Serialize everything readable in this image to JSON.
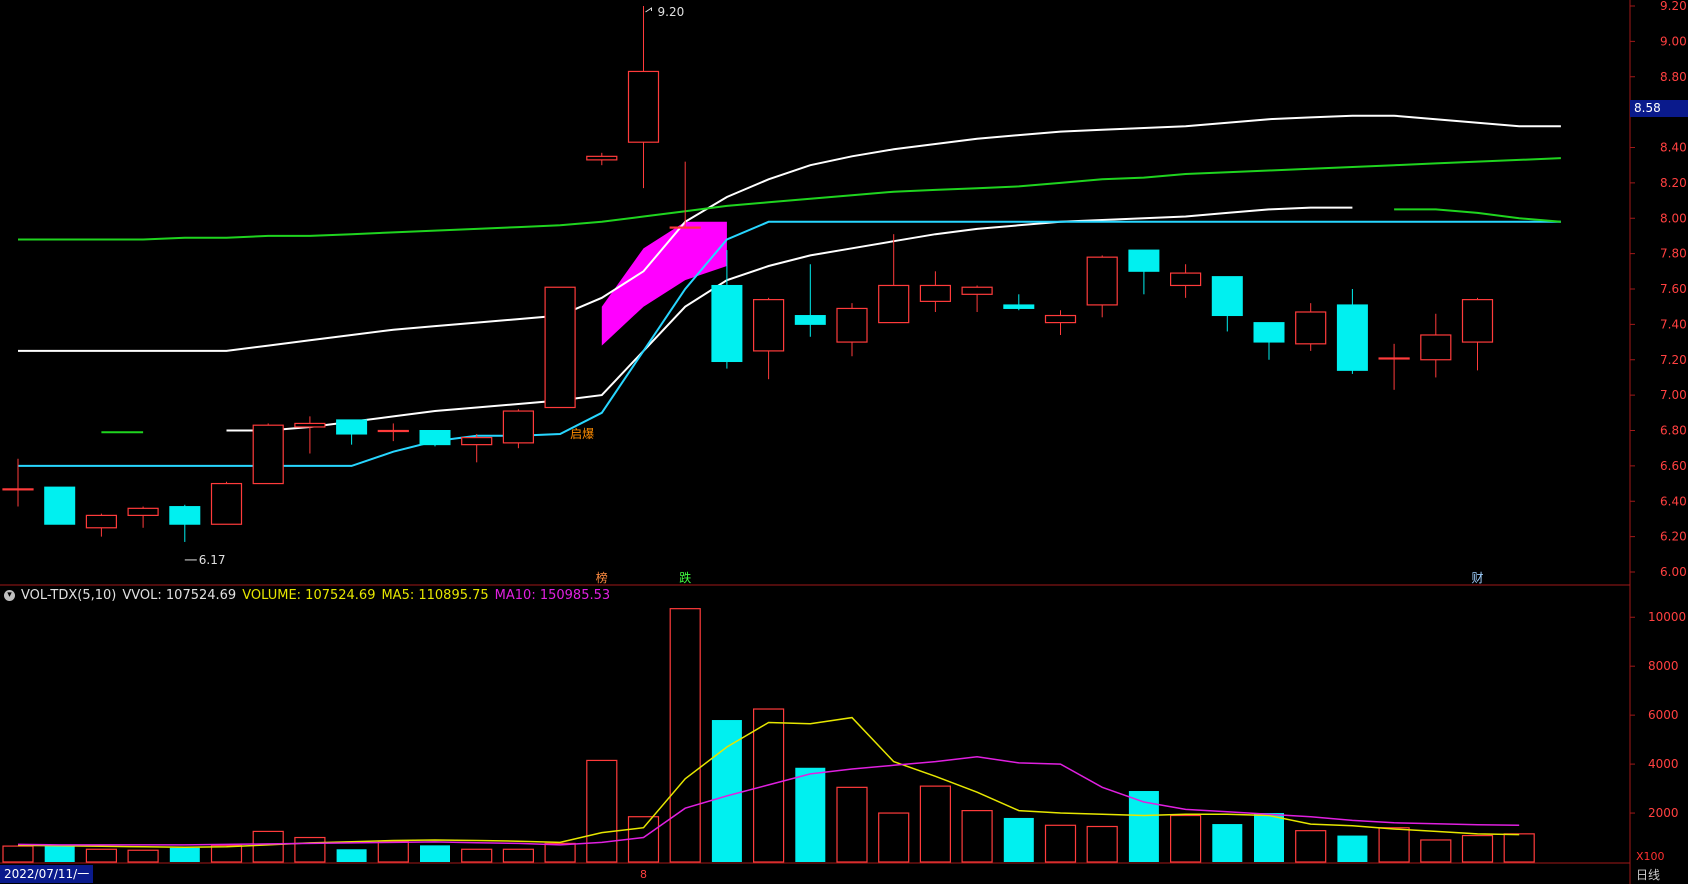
{
  "colors": {
    "up": "#ff3b3b",
    "down": "#00f0f0",
    "ma_white": "#ffffff",
    "ma_green": "#1fd41f",
    "ma_cyan": "#28d6ff",
    "fill_magenta": "#ff00ff",
    "vol_ma5": "#e6e600",
    "vol_ma10": "#e020e0",
    "axis": "#a01818",
    "grid": "#5a0d0d"
  },
  "header": {
    "indicator": "VOL-TDX(5,10)",
    "vvol": "VVOL: 107524.69",
    "volume": "VOLUME: 107524.69",
    "ma5": "MA5: 110895.75",
    "ma10": "MA10: 150985.53"
  },
  "footer": {
    "date": "2022/07/11/一",
    "period": "日线",
    "x_marker": "8",
    "vol_unit": "X100"
  },
  "current_price_tag": "8.58",
  "annotations": {
    "high_label": "9.20",
    "low_label": "6.17",
    "event_label": "启爆",
    "marker_bang": "榜",
    "marker_die": "跌",
    "marker_cai": "财"
  },
  "chart_data": [
    {
      "type": "candlestick",
      "ylim": [
        6.0,
        9.2
      ],
      "y_ticks": [
        "6.00",
        "6.20",
        "6.40",
        "6.60",
        "6.80",
        "7.00",
        "7.20",
        "7.40",
        "7.60",
        "7.80",
        "8.00",
        "8.20",
        "8.40",
        "8.60",
        "8.80",
        "9.00",
        "9.20"
      ],
      "candles": [
        {
          "o": 6.47,
          "h": 6.64,
          "l": 6.37,
          "c": 6.47
        },
        {
          "o": 6.48,
          "h": 6.48,
          "l": 6.27,
          "c": 6.27
        },
        {
          "o": 6.25,
          "h": 6.33,
          "l": 6.2,
          "c": 6.32
        },
        {
          "o": 6.32,
          "h": 6.37,
          "l": 6.25,
          "c": 6.36
        },
        {
          "o": 6.37,
          "h": 6.38,
          "l": 6.17,
          "c": 6.27
        },
        {
          "o": 6.27,
          "h": 6.51,
          "l": 6.27,
          "c": 6.5
        },
        {
          "o": 6.5,
          "h": 6.84,
          "l": 6.5,
          "c": 6.83
        },
        {
          "o": 6.82,
          "h": 6.88,
          "l": 6.67,
          "c": 6.84
        },
        {
          "o": 6.86,
          "h": 6.86,
          "l": 6.72,
          "c": 6.78
        },
        {
          "o": 6.8,
          "h": 6.84,
          "l": 6.74,
          "c": 6.8
        },
        {
          "o": 6.8,
          "h": 6.8,
          "l": 6.71,
          "c": 6.72
        },
        {
          "o": 6.72,
          "h": 6.78,
          "l": 6.62,
          "c": 6.76
        },
        {
          "o": 6.73,
          "h": 6.92,
          "l": 6.7,
          "c": 6.91
        },
        {
          "o": 6.93,
          "h": 7.61,
          "l": 6.93,
          "c": 7.61
        },
        {
          "o": 8.33,
          "h": 8.37,
          "l": 8.3,
          "c": 8.35
        },
        {
          "o": 8.43,
          "h": 9.2,
          "l": 8.17,
          "c": 8.83
        },
        {
          "o": 7.95,
          "h": 8.32,
          "l": 7.95,
          "c": 7.95
        },
        {
          "o": 7.62,
          "h": 7.82,
          "l": 7.15,
          "c": 7.19
        },
        {
          "o": 7.25,
          "h": 7.55,
          "l": 7.09,
          "c": 7.54
        },
        {
          "o": 7.45,
          "h": 7.74,
          "l": 7.33,
          "c": 7.4
        },
        {
          "o": 7.3,
          "h": 7.52,
          "l": 7.22,
          "c": 7.49
        },
        {
          "o": 7.41,
          "h": 7.91,
          "l": 7.41,
          "c": 7.62
        },
        {
          "o": 7.53,
          "h": 7.7,
          "l": 7.47,
          "c": 7.62
        },
        {
          "o": 7.57,
          "h": 7.62,
          "l": 7.47,
          "c": 7.61
        },
        {
          "o": 7.51,
          "h": 7.57,
          "l": 7.48,
          "c": 7.49
        },
        {
          "o": 7.41,
          "h": 7.48,
          "l": 7.34,
          "c": 7.45
        },
        {
          "o": 7.51,
          "h": 7.79,
          "l": 7.44,
          "c": 7.78
        },
        {
          "o": 7.82,
          "h": 7.82,
          "l": 7.57,
          "c": 7.7
        },
        {
          "o": 7.62,
          "h": 7.74,
          "l": 7.55,
          "c": 7.69
        },
        {
          "o": 7.67,
          "h": 7.67,
          "l": 7.36,
          "c": 7.45
        },
        {
          "o": 7.41,
          "h": 7.41,
          "l": 7.2,
          "c": 7.3
        },
        {
          "o": 7.29,
          "h": 7.52,
          "l": 7.25,
          "c": 7.47
        },
        {
          "o": 7.51,
          "h": 7.6,
          "l": 7.12,
          "c": 7.14
        },
        {
          "o": 7.21,
          "h": 7.29,
          "l": 7.03,
          "c": 7.21
        },
        {
          "o": 7.2,
          "h": 7.46,
          "l": 7.1,
          "c": 7.34
        },
        {
          "o": 7.3,
          "h": 7.55,
          "l": 7.14,
          "c": 7.54
        }
      ],
      "ma_white_upper": [
        7.25,
        7.25,
        7.25,
        7.25,
        7.25,
        7.25,
        7.28,
        7.31,
        7.34,
        7.37,
        7.39,
        7.41,
        7.43,
        7.45,
        7.55,
        7.7,
        7.98,
        8.12,
        8.22,
        8.3,
        8.35,
        8.39,
        8.42,
        8.45,
        8.47,
        8.49,
        8.5,
        8.51,
        8.52,
        8.54,
        8.56,
        8.57,
        8.58,
        8.58,
        8.56,
        8.54,
        8.52,
        8.52
      ],
      "ma_white_lower": [
        6.8,
        null,
        6.8,
        null,
        null,
        6.8,
        6.8,
        6.82,
        6.85,
        6.88,
        6.91,
        6.93,
        6.95,
        6.97,
        7.0,
        7.25,
        7.5,
        7.65,
        7.73,
        7.79,
        7.83,
        7.87,
        7.91,
        7.94,
        7.96,
        7.98,
        7.99,
        8.0,
        8.01,
        8.03,
        8.05,
        8.06,
        8.06
      ],
      "ma_green_upper": [
        7.88,
        7.88,
        7.88,
        7.88,
        7.89,
        7.89,
        7.9,
        7.9,
        7.91,
        7.92,
        7.93,
        7.94,
        7.95,
        7.96,
        7.98,
        8.01,
        8.04,
        8.07,
        8.09,
        8.11,
        8.13,
        8.15,
        8.16,
        8.17,
        8.18,
        8.2,
        8.22,
        8.23,
        8.25,
        8.26,
        8.27,
        8.28,
        8.29,
        8.3,
        8.31,
        8.32,
        8.33,
        8.34
      ],
      "ma_green_lower": [
        6.79,
        null,
        6.79,
        6.79
      ],
      "ma_cyan": [
        6.6,
        6.6,
        6.6,
        6.6,
        6.6,
        6.6,
        6.6,
        6.6,
        6.6,
        6.68,
        6.74,
        6.77,
        6.77,
        6.78,
        6.9,
        7.25,
        7.6,
        7.88,
        7.98,
        7.98,
        7.98,
        7.98,
        7.98,
        7.98,
        7.98,
        7.98,
        7.98,
        7.98,
        7.98,
        7.98,
        7.98,
        7.98,
        7.98,
        7.98,
        7.98,
        7.98,
        7.98,
        7.98
      ],
      "ma_green_tail": [
        8.05,
        8.05,
        8.03,
        8.0,
        7.98
      ]
    },
    {
      "type": "volume",
      "ylim": [
        0,
        10500
      ],
      "y_ticks": [
        "2000",
        "4000",
        "6000",
        "8000",
        "10000"
      ],
      "unit": "X100",
      "volumes": [
        650,
        650,
        520,
        480,
        580,
        680,
        1250,
        1000,
        520,
        850,
        680,
        520,
        520,
        760,
        4150,
        1850,
        10350,
        5800,
        6250,
        3850,
        3050,
        2000,
        3100,
        2100,
        1800,
        1500,
        1450,
        2900,
        1900,
        1550,
        2000,
        1280,
        1080,
        1400,
        900,
        1080,
        1150
      ],
      "vol_ma5": [
        680,
        660,
        640,
        620,
        600,
        620,
        700,
        780,
        830,
        880,
        900,
        880,
        850,
        800,
        1200,
        1400,
        3400,
        4700,
        5700,
        5650,
        5900,
        4100,
        3500,
        2850,
        2100,
        2000,
        1950,
        1900,
        1950,
        1950,
        1900,
        1550,
        1480,
        1350,
        1250,
        1150,
        1120
      ],
      "vol_ma10": [
        720,
        700,
        700,
        700,
        700,
        720,
        740,
        760,
        780,
        800,
        820,
        790,
        760,
        700,
        800,
        1000,
        2200,
        2700,
        3150,
        3600,
        3800,
        3950,
        4100,
        4300,
        4050,
        4000,
        3050,
        2450,
        2150,
        2050,
        1950,
        1850,
        1700,
        1600,
        1560,
        1520,
        1500
      ]
    }
  ]
}
